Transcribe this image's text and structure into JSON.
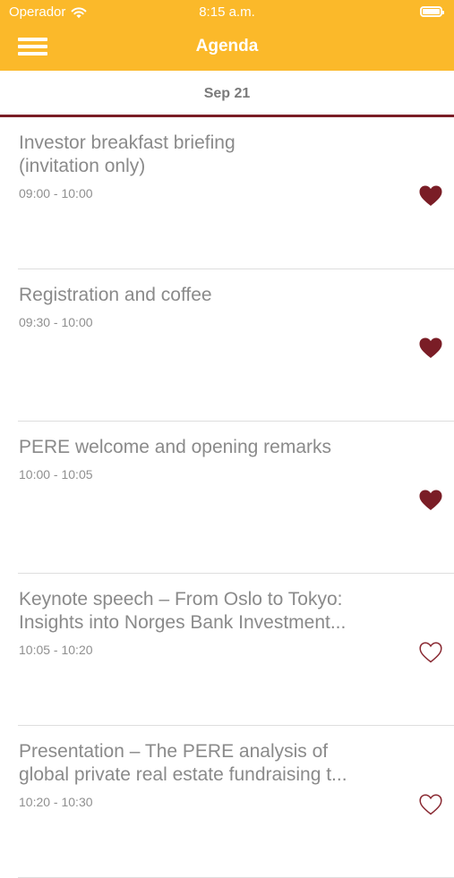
{
  "status_bar": {
    "carrier": "Operador",
    "time": "8:15 a.m."
  },
  "nav": {
    "title": "Agenda"
  },
  "date_bar": {
    "label": "Sep 21"
  },
  "colors": {
    "header": "#fbb92a",
    "accent": "#7a1d26",
    "text": "#8a8a8a"
  },
  "sessions": [
    {
      "title": "Investor breakfast briefing\n(invitation only)",
      "time": "09:00 - 10:00",
      "favorite": true
    },
    {
      "title": "Registration and coffee",
      "time": "09:30 - 10:00",
      "favorite": true
    },
    {
      "title": "PERE welcome and opening remarks",
      "time": "10:00 - 10:05",
      "favorite": true
    },
    {
      "title": "Keynote speech – From Oslo to Tokyo:\nInsights into Norges Bank Investment...",
      "time": "10:05 - 10:20",
      "favorite": false
    },
    {
      "title": "Presentation – The PERE analysis of\nglobal private real estate fundraising t...",
      "time": "10:20 - 10:30",
      "favorite": false
    }
  ]
}
